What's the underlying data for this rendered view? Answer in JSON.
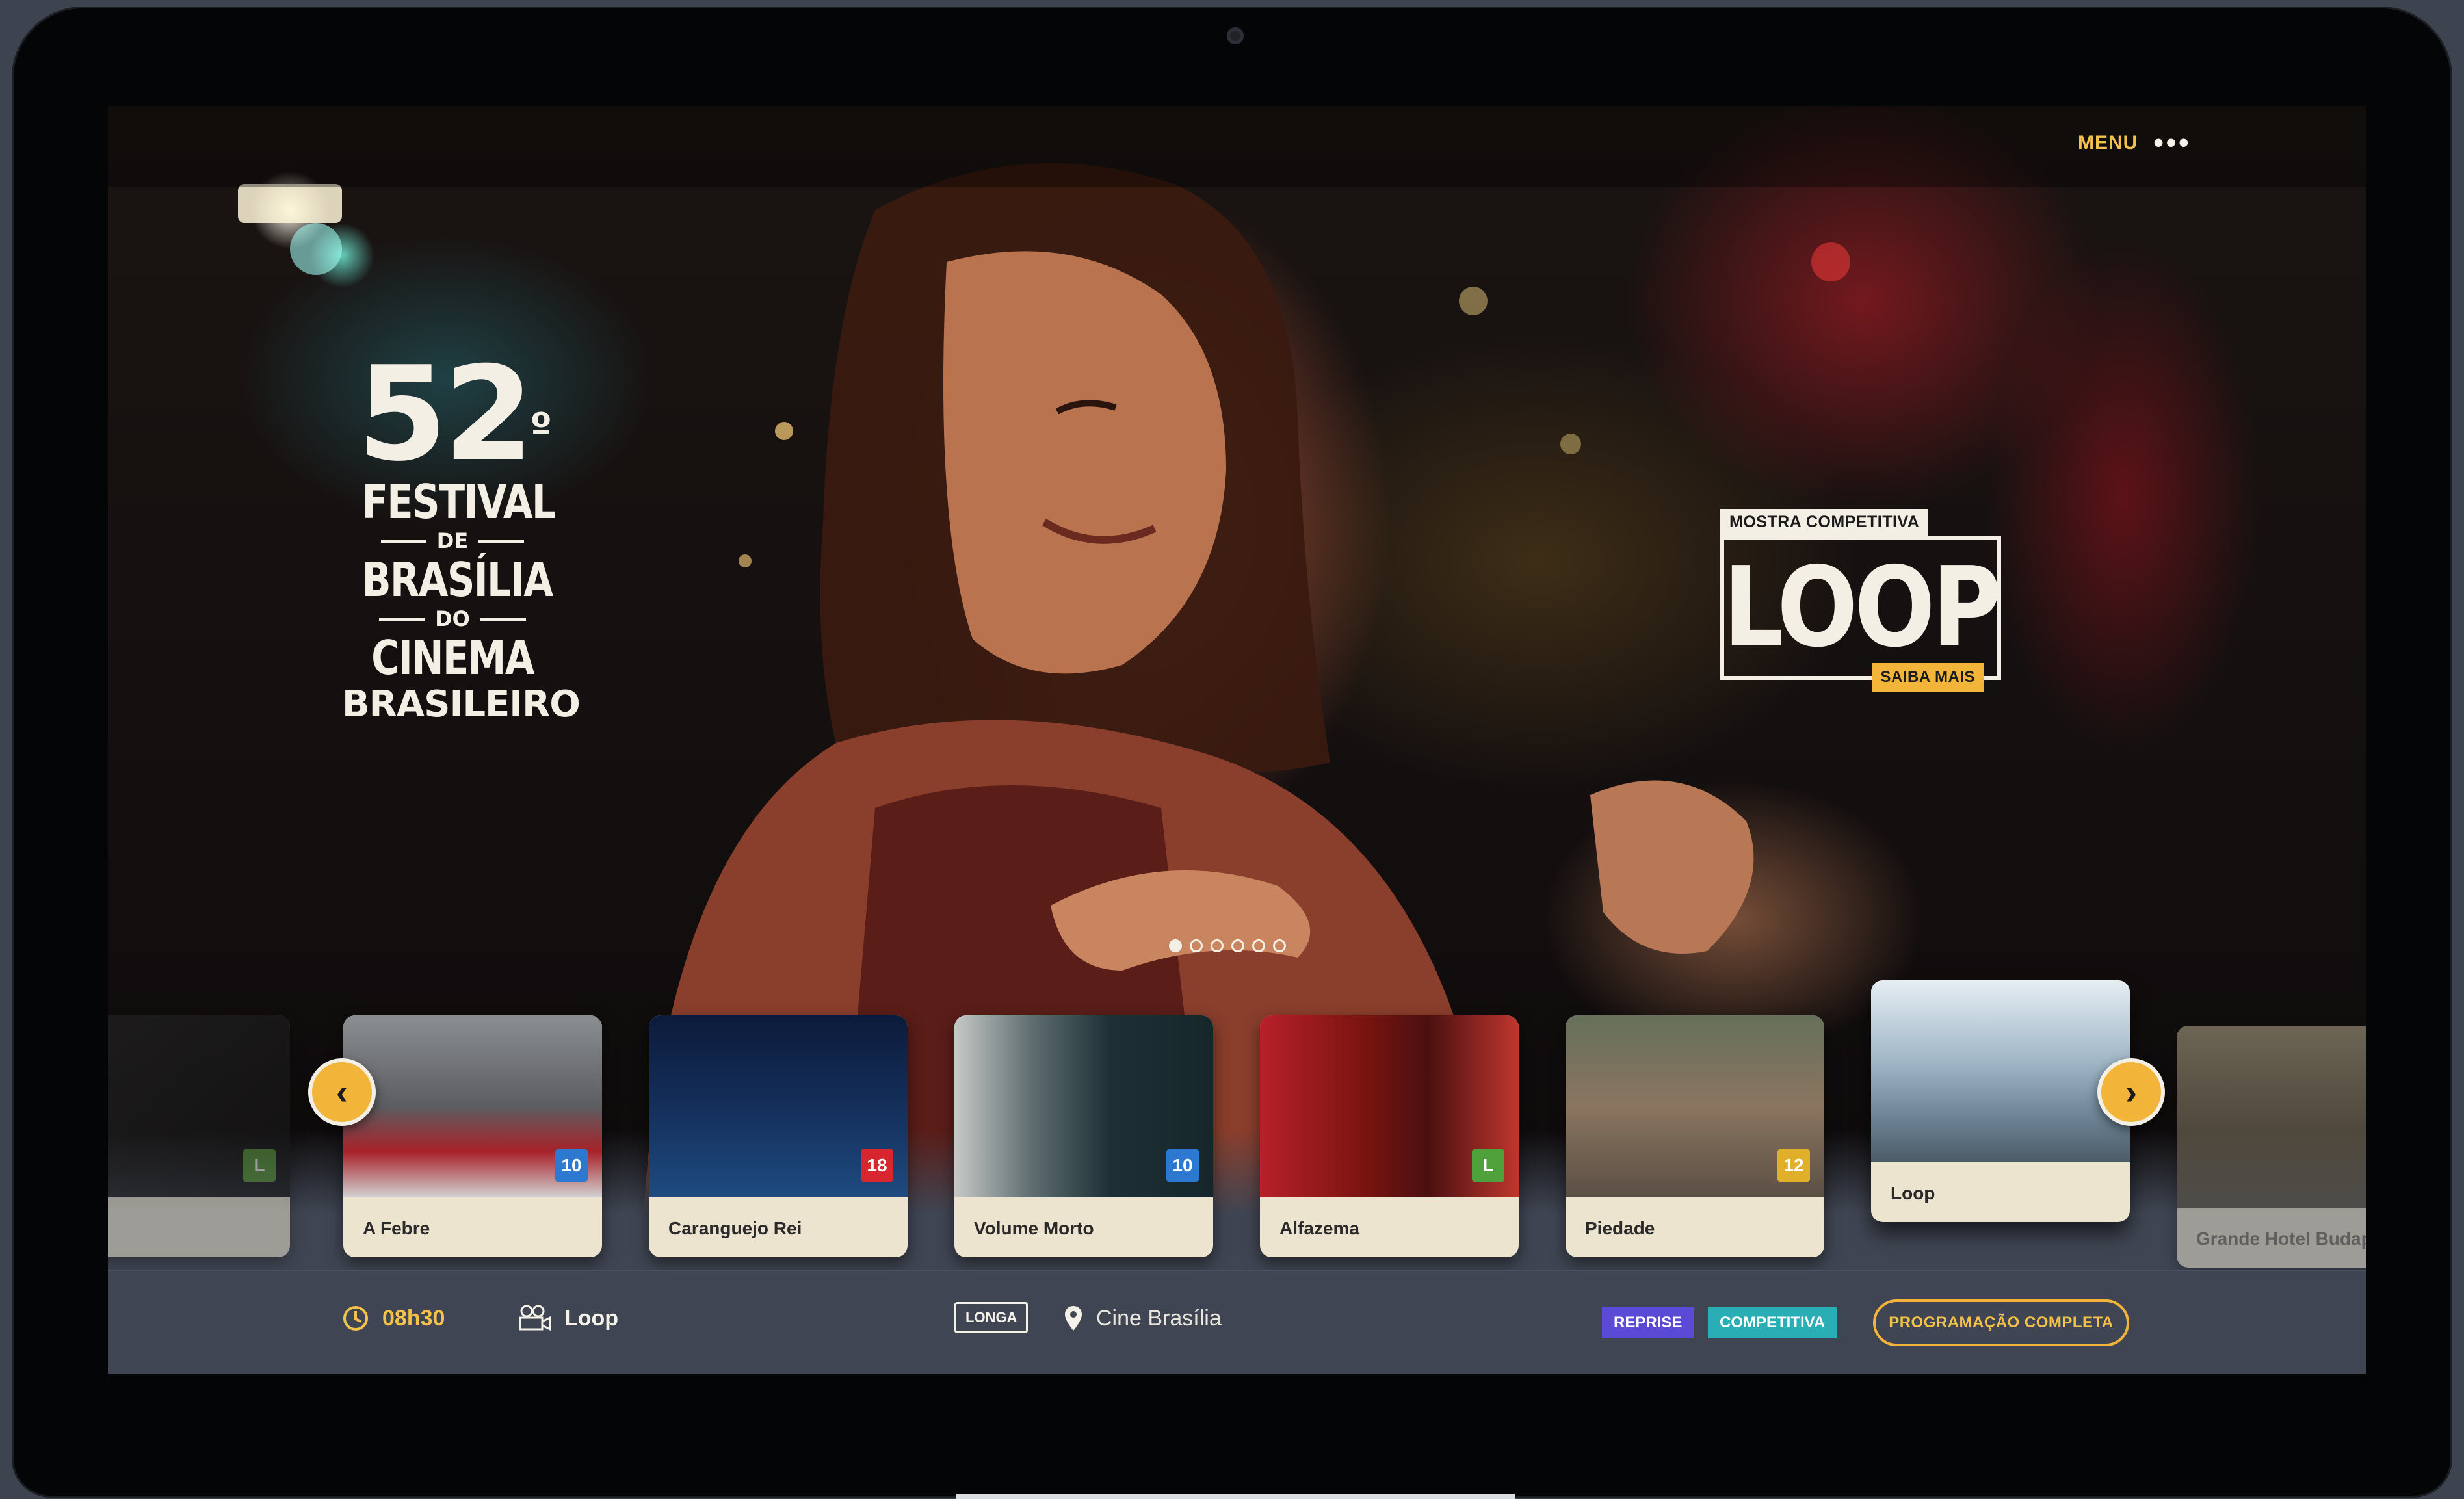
{
  "header": {
    "menu_label": "MENU",
    "menu_dots": "•••"
  },
  "logo": {
    "number": "52",
    "ordinal": "º",
    "line1": "FESTIVAL",
    "line2": "DE",
    "line3": "BRASÍLIA",
    "line4": "DO",
    "line5": "CINEMA",
    "line6": "BRASILEIRO"
  },
  "feature": {
    "tag": "MOSTRA COMPETITIVA",
    "title": "LOOP",
    "more": "SAIBA MAIS"
  },
  "carousel": {
    "slide_count": 6,
    "active_index": 0,
    "prev_icon": "chevron-left-icon",
    "next_icon": "chevron-right-icon"
  },
  "films": [
    {
      "title": "",
      "rating": "L",
      "rating_color": "#5a9a3a"
    },
    {
      "title": "A Febre",
      "rating": "10",
      "rating_color": "#2d79d2"
    },
    {
      "title": "Caranguejo Rei",
      "rating": "18",
      "rating_color": "#d8262e"
    },
    {
      "title": "Volume Morto",
      "rating": "10",
      "rating_color": "#2d79d2"
    },
    {
      "title": "Alfazema",
      "rating": "L",
      "rating_color": "#4fa13b"
    },
    {
      "title": "Piedade",
      "rating": "12",
      "rating_color": "#e0b02a"
    },
    {
      "title": "Loop",
      "rating": "",
      "rating_color": "#2d79d2"
    },
    {
      "title": "Grande Hotel Budapest",
      "rating": "",
      "rating_color": "#2d79d2"
    }
  ],
  "info": {
    "time": "08h30",
    "film": "Loop",
    "format": "LONGA",
    "venue": "Cine Brasília",
    "badge_reprise": "REPRISE",
    "badge_competitiva": "COMPETITIVA",
    "full_program": "PROGRAMAÇÃO COMPLETA"
  },
  "colors": {
    "accent": "#f2b53a",
    "reprise": "#5a4ad6",
    "competitiva": "#28aeb4",
    "infobar": "#3f4552"
  }
}
